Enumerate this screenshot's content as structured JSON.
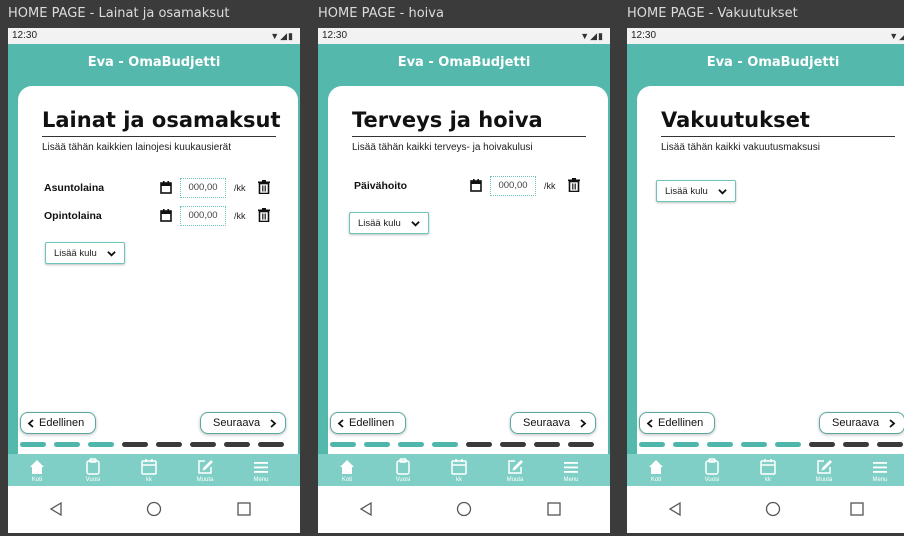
{
  "app_title": "Eva - OmaBudjetti",
  "status_time": "12:30",
  "status_icons": "▼◢▮",
  "amount_placeholder": "000,00",
  "per_month": "/kk",
  "add_expense": "Lisää kulu",
  "prev_label": "Edellinen",
  "next_label": "Seuraava",
  "tabs": [
    {
      "label": "Koti",
      "icon": "home-icon"
    },
    {
      "label": "Vuosi",
      "icon": "year-icon"
    },
    {
      "label": "kk",
      "icon": "calendar-icon"
    },
    {
      "label": "Muuta",
      "icon": "edit-icon"
    },
    {
      "label": "Menu",
      "icon": "menu-icon"
    }
  ],
  "colors": {
    "teal": "#54b8ad",
    "teal_light": "#7fcfc6",
    "progress_active": "#4fb6ab",
    "progress_inactive": "#3a3a3a"
  },
  "screens": [
    {
      "window_title": "HOME PAGE - Lainat ja osamaksut",
      "heading": "Lainat ja osamaksut",
      "subtitle": "Lisää tähän kaikkien lainojesi kuukausierät",
      "rows": [
        {
          "label": "Asuntolaina"
        },
        {
          "label": "Opintolaina"
        }
      ],
      "progress_completed": 3,
      "progress_total": 8
    },
    {
      "window_title": "HOME PAGE - hoiva",
      "heading": "Terveys ja hoiva",
      "subtitle": "Lisää tähän kaikki terveys- ja hoivakulusi",
      "rows": [
        {
          "label": "Päivähoito"
        }
      ],
      "progress_completed": 4,
      "progress_total": 8
    },
    {
      "window_title": "HOME PAGE - Vakuutukset",
      "heading": "Vakuutukset",
      "subtitle": "Lisää tähän kaikki vakuutusmaksusi",
      "rows": [],
      "progress_completed": 5,
      "progress_total": 8
    }
  ]
}
